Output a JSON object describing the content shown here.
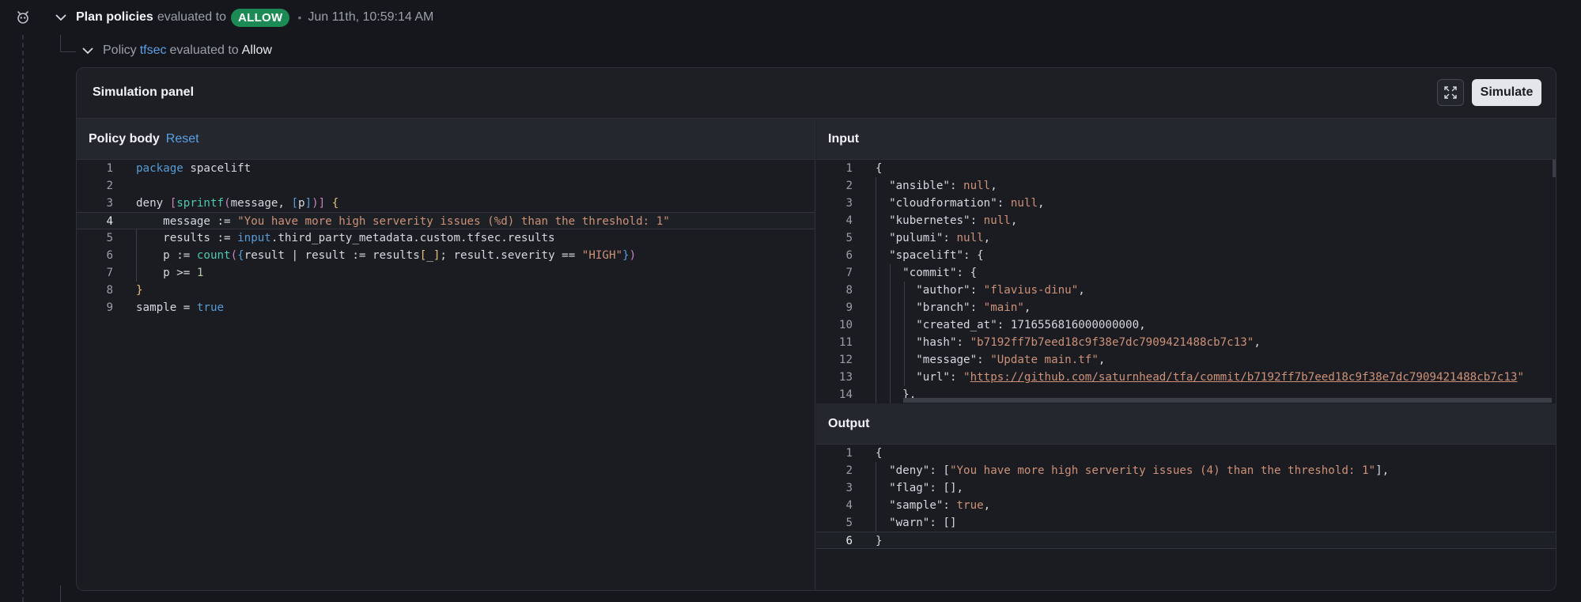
{
  "header": {
    "title": "Plan policies",
    "evaluated_text": "evaluated to",
    "status_badge": "ALLOW",
    "separator": "•",
    "timestamp": "Jun 11th, 10:59:14 AM",
    "status_color": "#1b8a54"
  },
  "subheader": {
    "prefix": "Policy",
    "policy_name": "tfsec",
    "evaluated_text": "evaluated to",
    "result": "Allow"
  },
  "panel": {
    "title": "Simulation panel",
    "expand_icon": "expand-icon",
    "simulate_label": "Simulate"
  },
  "policy_body": {
    "title": "Policy body",
    "reset_label": "Reset",
    "lines": [
      {
        "n": "1",
        "text": "package spacelift"
      },
      {
        "n": "2",
        "text": ""
      },
      {
        "n": "3",
        "text": "deny [sprintf(message, [p])] {"
      },
      {
        "n": "4",
        "text": "    message := \"You have more high serverity issues (%d) than the threshold: 1\""
      },
      {
        "n": "5",
        "text": "    results := input.third_party_metadata.custom.tfsec.results"
      },
      {
        "n": "6",
        "text": "    p := count({result | result := results[_]; result.severity == \"HIGH\"})"
      },
      {
        "n": "7",
        "text": "    p >= 1"
      },
      {
        "n": "8",
        "text": "}"
      },
      {
        "n": "9",
        "text": "sample = true"
      }
    ]
  },
  "input": {
    "title": "Input",
    "lines": [
      {
        "n": "1",
        "text": "{"
      },
      {
        "n": "2",
        "text": "  \"ansible\": null,"
      },
      {
        "n": "3",
        "text": "  \"cloudformation\": null,"
      },
      {
        "n": "4",
        "text": "  \"kubernetes\": null,"
      },
      {
        "n": "5",
        "text": "  \"pulumi\": null,"
      },
      {
        "n": "6",
        "text": "  \"spacelift\": {"
      },
      {
        "n": "7",
        "text": "    \"commit\": {"
      },
      {
        "n": "8",
        "text": "      \"author\": \"flavius-dinu\","
      },
      {
        "n": "9",
        "text": "      \"branch\": \"main\","
      },
      {
        "n": "10",
        "text": "      \"created_at\": 1716556816000000000,"
      },
      {
        "n": "11",
        "text": "      \"hash\": \"b7192ff7b7eed18c9f38e7dc7909421488cb7c13\","
      },
      {
        "n": "12",
        "text": "      \"message\": \"Update main.tf\","
      },
      {
        "n": "13",
        "text": "      \"url\": \"https://github.com/saturnhead/tfa/commit/b7192ff7b7eed18c9f38e7dc7909421488cb7c13\""
      },
      {
        "n": "14",
        "text": "    },"
      }
    ]
  },
  "output": {
    "title": "Output",
    "lines": [
      {
        "n": "1",
        "text": "{"
      },
      {
        "n": "2",
        "text": "  \"deny\": [\"You have more high serverity issues (4) than the threshold: 1\"],"
      },
      {
        "n": "3",
        "text": "  \"flag\": [],"
      },
      {
        "n": "4",
        "text": "  \"sample\": true,"
      },
      {
        "n": "5",
        "text": "  \"warn\": []"
      },
      {
        "n": "6",
        "text": "}"
      }
    ]
  }
}
